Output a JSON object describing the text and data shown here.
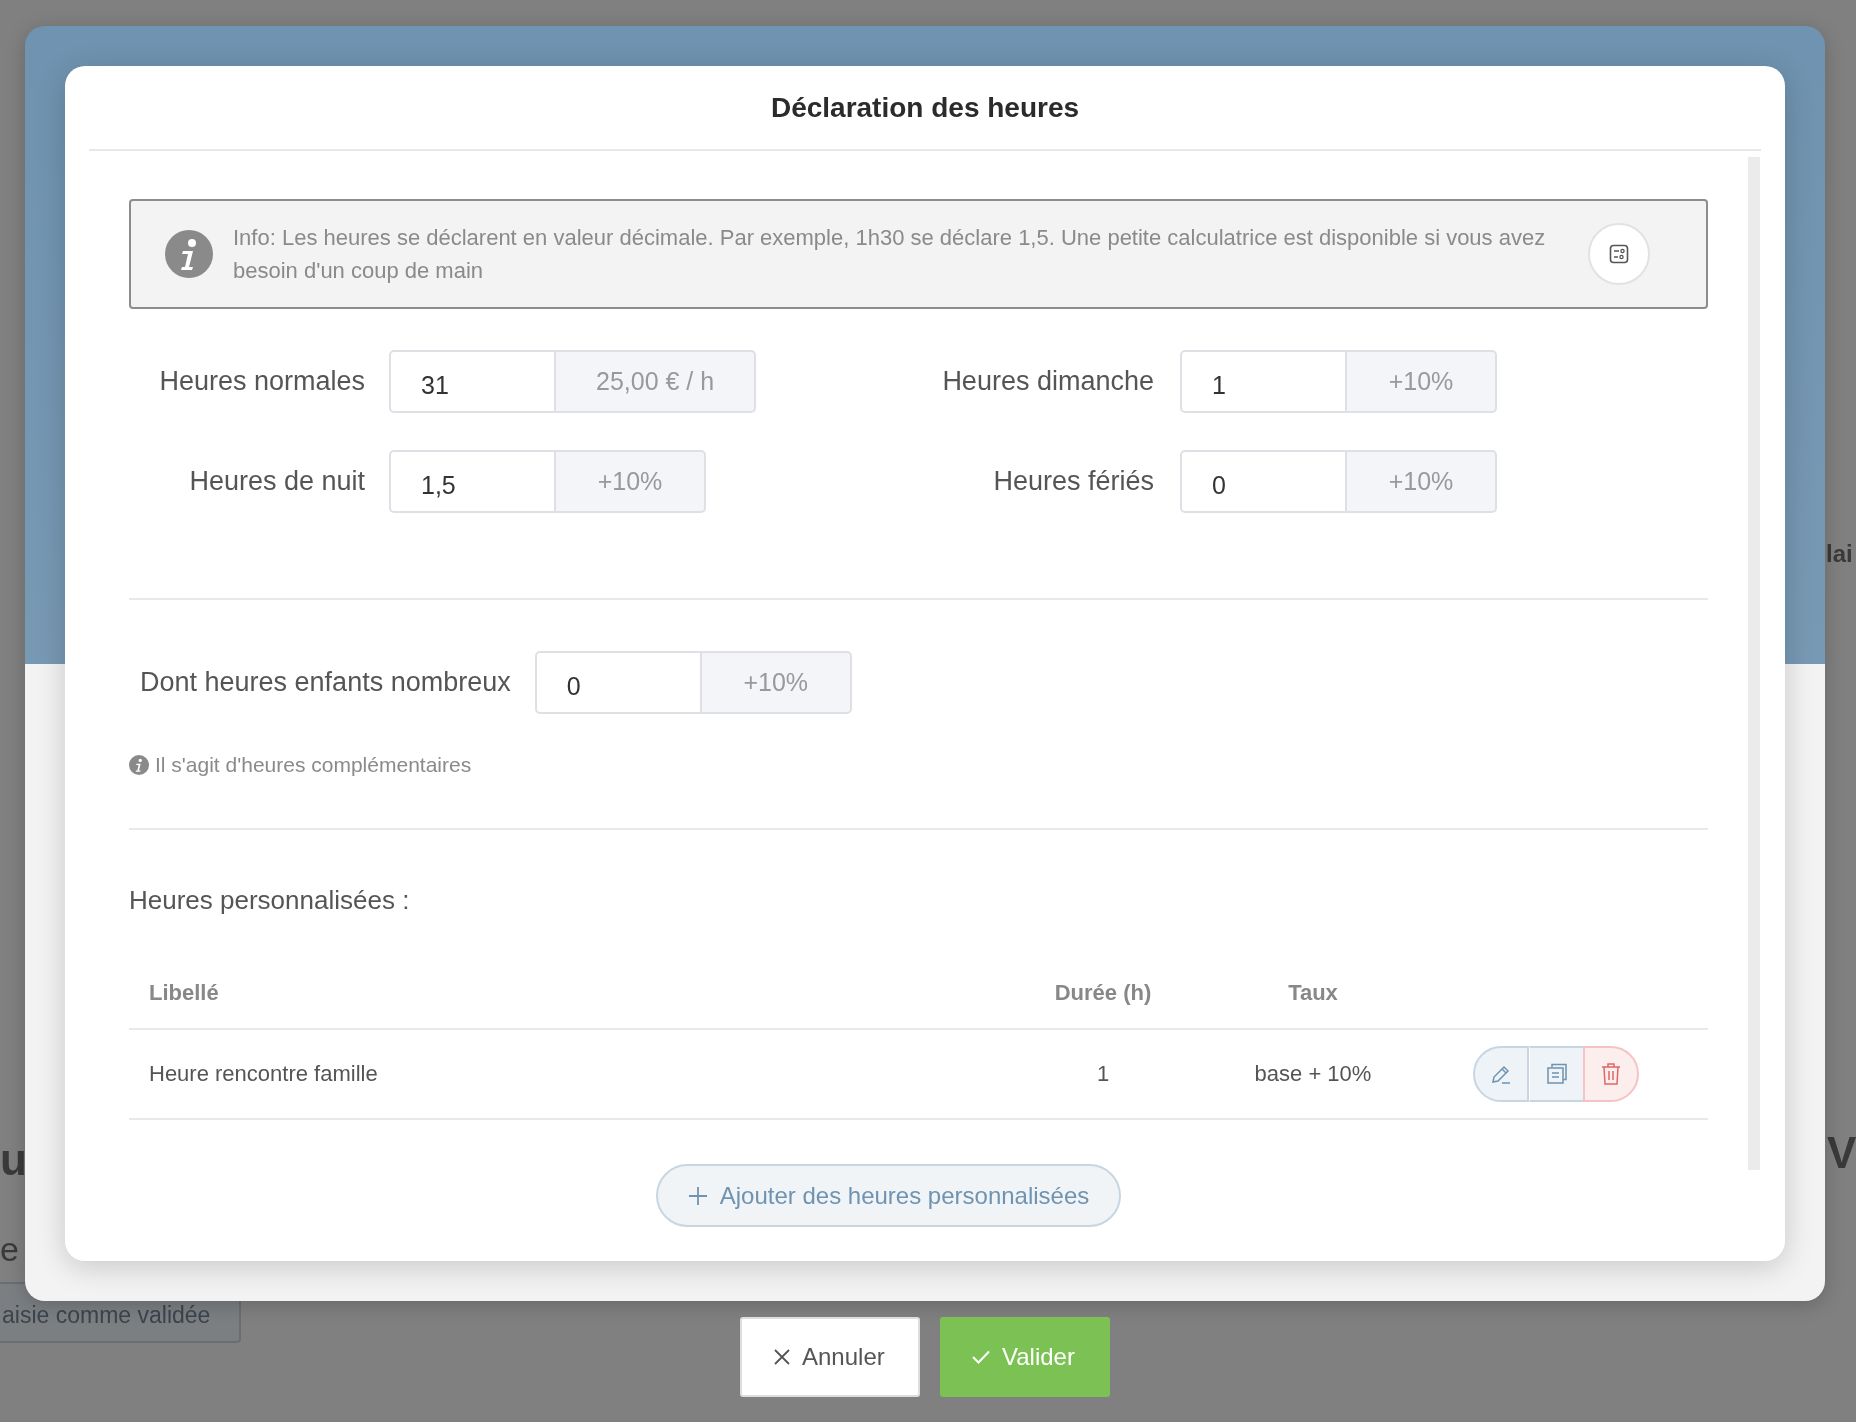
{
  "background": {
    "fragments": [
      {
        "text": "lai"
      },
      {
        "text": "u"
      },
      {
        "text": "V"
      },
      {
        "text": "e"
      }
    ],
    "button": "aisie comme validée"
  },
  "dialog": {
    "title": "Déclaration des heures",
    "info": "Info: Les heures se déclarent en valeur décimale. Par exemple, 1h30 se déclare 1,5. Une petite calculatrice est disponible si vous avez besoin d'un coup de main",
    "fields": [
      {
        "label": "Heures normales",
        "value": "31",
        "addon": "25,00 € / h"
      },
      {
        "label": "Heures dimanche",
        "value": "1",
        "addon": "+10%"
      },
      {
        "label": "Heures de nuit",
        "value": "1,5",
        "addon": "+10%"
      },
      {
        "label": "Heures fériés",
        "value": "0",
        "addon": "+10%"
      }
    ],
    "extra_field": {
      "label": "Dont heures enfants nombreux",
      "value": "0",
      "addon": "+10%"
    },
    "hint": "Il s'agit d'heures complémentaires",
    "custom": {
      "title": "Heures personnalisées :",
      "columns": [
        "Libellé",
        "Durée (h)",
        "Taux"
      ],
      "rows": [
        {
          "label": "Heure rencontre famille",
          "duration": "1",
          "rate": "base + 10%"
        }
      ],
      "add_button": "Ajouter des heures personnalisées"
    }
  },
  "footer_buttons": [
    {
      "label": "Annuler",
      "kind": "cancel"
    },
    {
      "label": "Valider",
      "kind": "confirm"
    }
  ]
}
